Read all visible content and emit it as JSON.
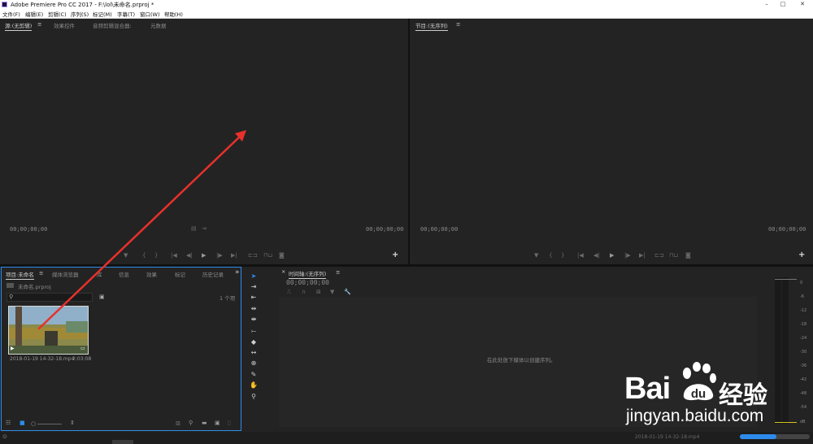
{
  "window": {
    "title": "Adobe Premiere Pro CC 2017 - F:\\lol\\未命名.prproj *",
    "controls": [
      "–",
      "□",
      "✕"
    ]
  },
  "menu": [
    "文件(F)",
    "编辑(E)",
    "剪辑(C)",
    "序列(S)",
    "标记(M)",
    "字幕(T)",
    "窗口(W)",
    "帮助(H)"
  ],
  "source_panel": {
    "tabs": [
      "源:(无剪辑)",
      "效果控件",
      "音频剪辑混合器:",
      "元数据"
    ],
    "menu_glyph": "≡",
    "timecode_left": "00;00;00;00",
    "timecode_right": "00;00;00;00",
    "add_button": "+"
  },
  "program_panel": {
    "tab": "节目:(无序列)",
    "menu_glyph": "≡",
    "timecode_left": "00;00;00;00",
    "timecode_right": "00;00;00;00",
    "add_button": "+"
  },
  "project_panel": {
    "tabs": [
      "项目:未命名",
      "媒体浏览器",
      "库",
      "信息",
      "效果",
      "标记",
      "历史记录"
    ],
    "overflow": "»",
    "project_file": "未命名.prproj",
    "item_count": "1 个项",
    "clip": {
      "name": "2018-01-19 14-32-18.mp4",
      "duration": "2:03:08"
    }
  },
  "timeline_panel": {
    "tab": "时间轴:(无序列)",
    "menu_glyph": "≡",
    "timecode": "00;00;00;00",
    "drop_hint": "在此处放下媒体以创建序列。"
  },
  "audio_meter": {
    "ticks": [
      "0",
      "-6",
      "-12",
      "-18",
      "-24",
      "-30",
      "-36",
      "-42",
      "-48",
      "-54",
      "dB"
    ]
  },
  "status_bar": {
    "file_label": "2018-01-19 14-32-18.mp4"
  },
  "watermark": {
    "brand_latin": "Bai",
    "brand_paw": "du",
    "brand_cn": "经验",
    "url": "jingyan.baidu.com"
  },
  "colors": {
    "panel_bg": "#232323",
    "highlight_blue": "#2d8ceb",
    "annotation_arrow": "#e8312b",
    "meter_yellow": "#d4c21a"
  }
}
